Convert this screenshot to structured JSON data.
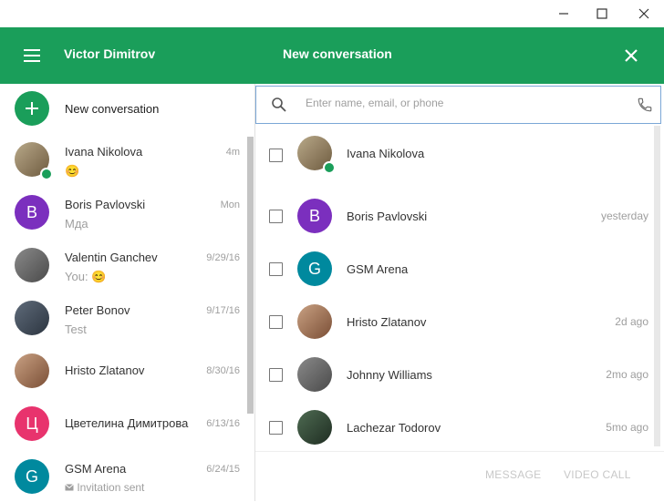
{
  "window": {
    "minimize_glyph": "—",
    "maximize_glyph": "☐",
    "close_glyph": "✕"
  },
  "header": {
    "user_name": "Victor Dimitrov",
    "panel_title": "New conversation"
  },
  "sidebar": {
    "new_conversation_label": "New conversation",
    "conversations": [
      {
        "name": "Ivana Nikolova",
        "time": "4m",
        "snippet": "😊",
        "avatar_type": "photo",
        "online": true
      },
      {
        "name": "Boris Pavlovski",
        "time": "Mon",
        "snippet": "Мда",
        "avatar_letter": "B",
        "avatar_color": "#7b2fbe"
      },
      {
        "name": "Valentin Ganchev",
        "time": "9/29/16",
        "snippet": "You: 😊",
        "avatar_type": "photo"
      },
      {
        "name": "Peter Bonov",
        "time": "9/17/16",
        "snippet": "Test",
        "avatar_type": "photo"
      },
      {
        "name": "Hristo Zlatanov",
        "time": "8/30/16",
        "snippet": "",
        "avatar_type": "photo"
      },
      {
        "name": "Цветелина Димитрова",
        "time": "6/13/16",
        "snippet": "",
        "avatar_letter": "Ц",
        "avatar_color": "#e8336d"
      },
      {
        "name": "GSM Arena",
        "time": "6/24/15",
        "snippet": "Invitation sent",
        "avatar_letter": "G",
        "avatar_color": "#00899e"
      }
    ]
  },
  "search": {
    "placeholder": "Enter name, email, or phone"
  },
  "contacts": [
    {
      "name": "Ivana Nikolova",
      "time": "",
      "avatar_type": "photo",
      "online": true
    },
    {
      "name": "Boris Pavlovski",
      "time": "yesterday",
      "avatar_letter": "B",
      "avatar_color": "#7b2fbe"
    },
    {
      "name": "GSM Arena",
      "time": "",
      "avatar_letter": "G",
      "avatar_color": "#00899e"
    },
    {
      "name": "Hristo Zlatanov",
      "time": "2d ago",
      "avatar_type": "photo"
    },
    {
      "name": "Johnny Williams",
      "time": "2mo ago",
      "avatar_type": "photo"
    },
    {
      "name": "Lachezar Todorov",
      "time": "5mo ago",
      "avatar_type": "photo"
    }
  ],
  "footer": {
    "message_label": "MESSAGE",
    "video_call_label": "VIDEO CALL"
  },
  "colors": {
    "accent": "#1a9e5a",
    "purple": "#7b2fbe",
    "pink": "#e8336d",
    "teal": "#00899e"
  }
}
